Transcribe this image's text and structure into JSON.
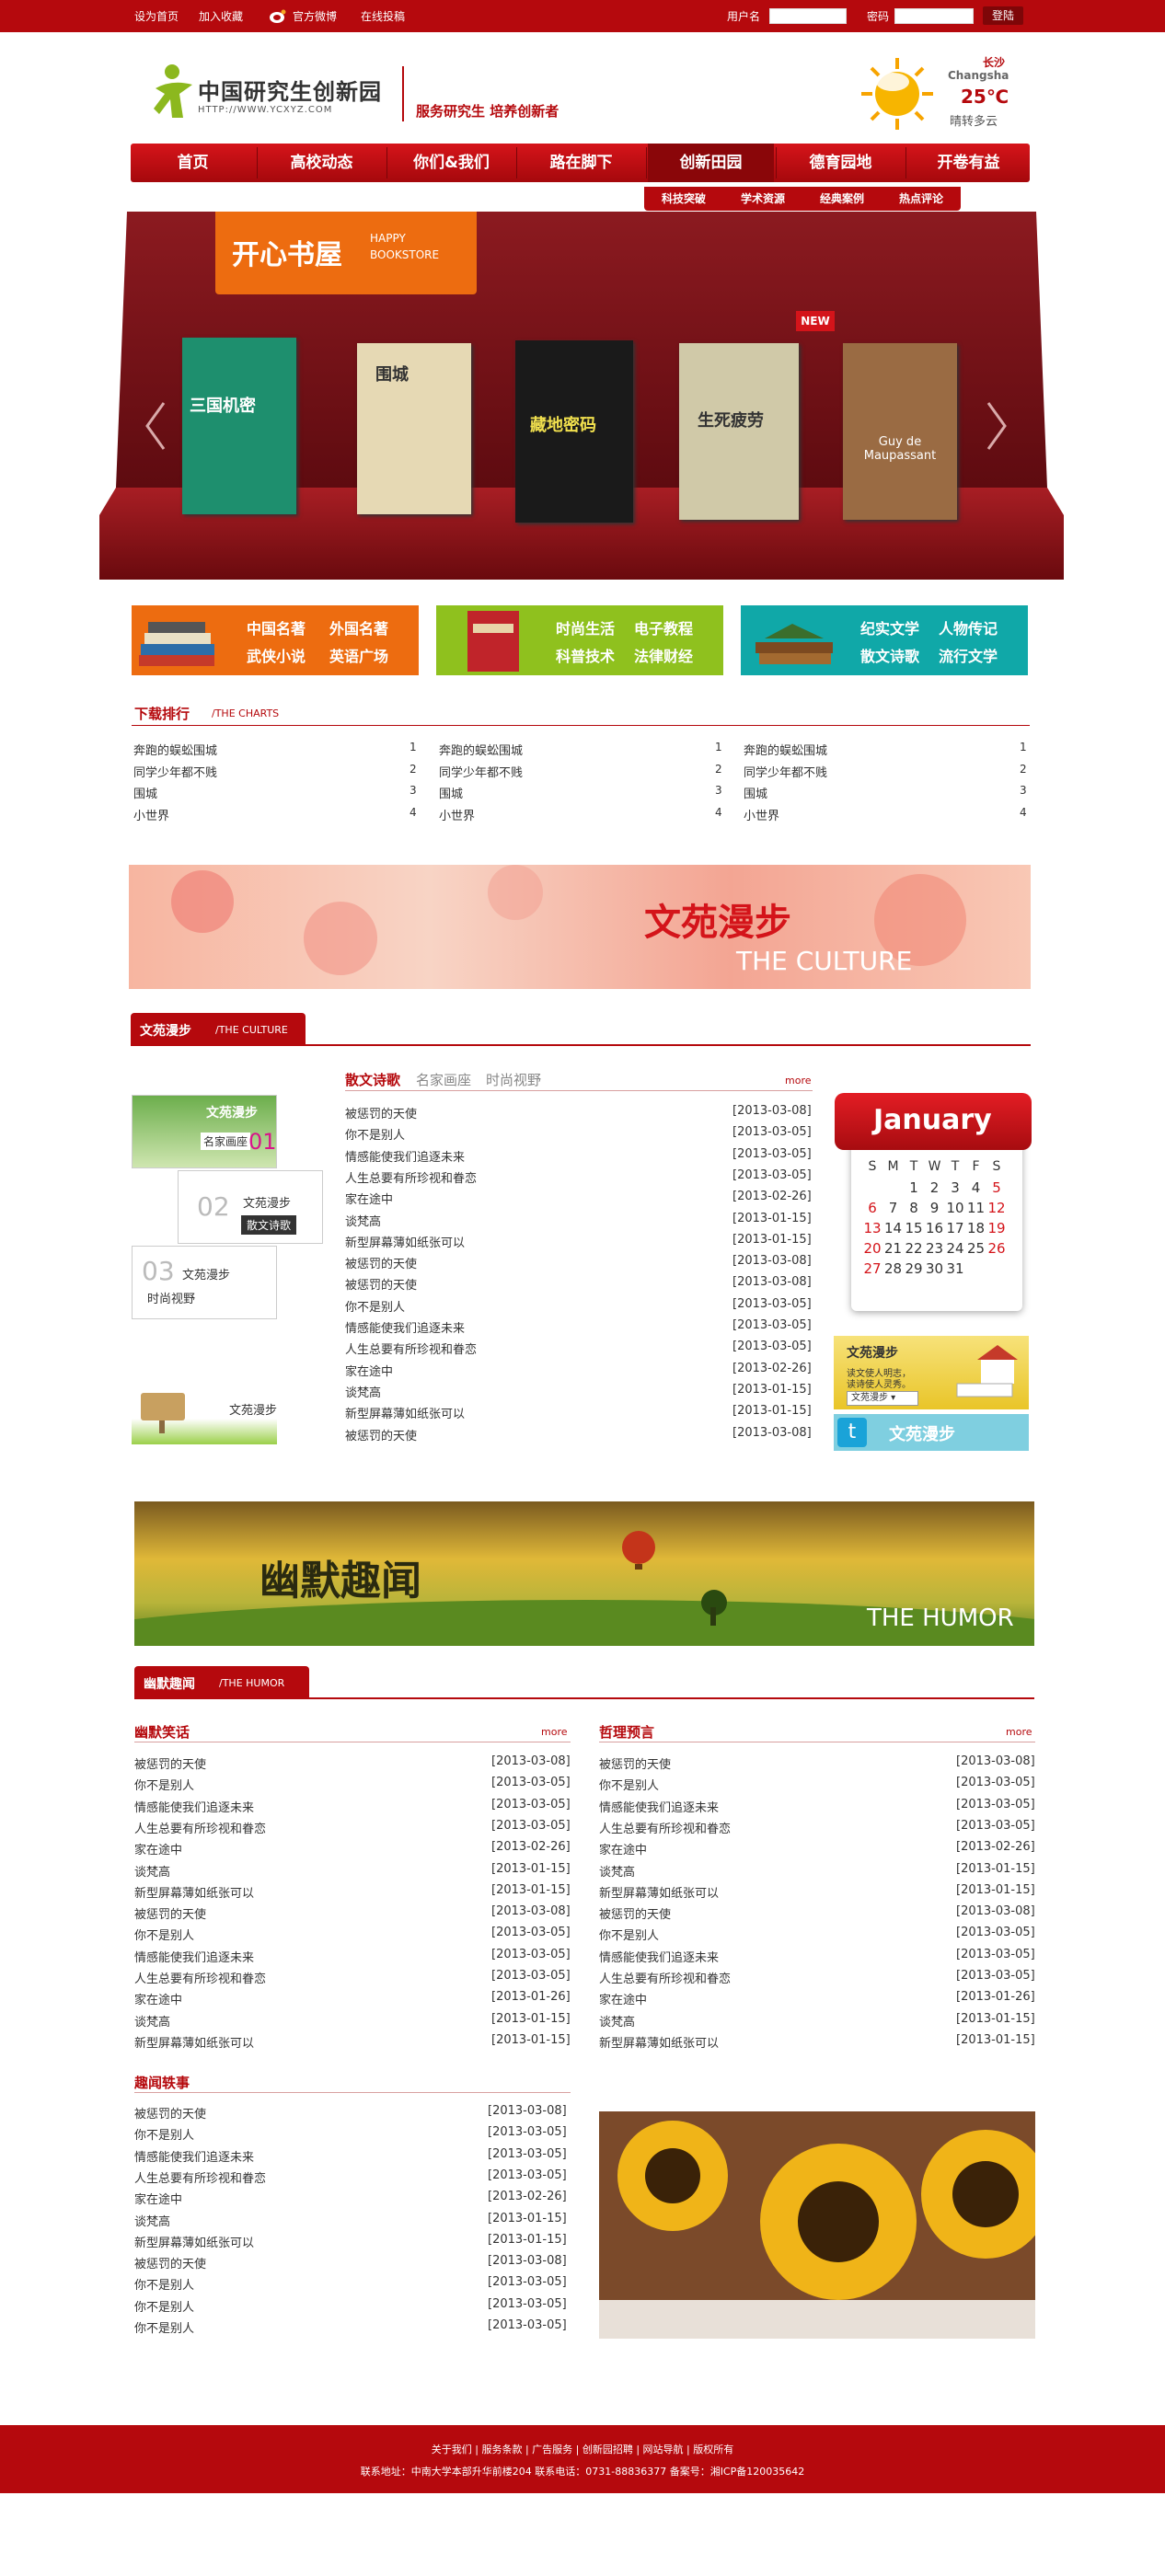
{
  "topbar": {
    "links": [
      "设为首页",
      "加入收藏",
      "官方微博",
      "在线投稿"
    ],
    "username_label": "用户名",
    "password_label": "密码",
    "login_label": "登陆"
  },
  "header": {
    "logo_text": "中国研究生创新园",
    "logo_url": "HTTP://WWW.YCXYZ.COM",
    "slogan": "服务研究生  培养创新者",
    "weather": {
      "city": "长沙",
      "city_en": "Changsha",
      "temp": "25℃",
      "desc": "晴转多云"
    }
  },
  "nav": {
    "items": [
      "首页",
      "高校动态",
      "你们&我们",
      "路在脚下",
      "创新田园",
      "德育园地",
      "开卷有益"
    ],
    "sub_items": [
      "科技突破",
      "学术资源",
      "经典案例",
      "热点评论"
    ]
  },
  "bookstore": {
    "title": "开心书屋",
    "title_en_1": "HAPPY",
    "title_en_2": "BOOKSTORE",
    "new_badge": "NEW",
    "books": [
      {
        "name": "三国机密",
        "color": "#2a8f72"
      },
      {
        "name": "围城",
        "color": "#d9c9a0"
      },
      {
        "name": "藏地密码",
        "color": "#222"
      },
      {
        "name": "生死疲劳",
        "color": "#c9c4a8"
      },
      {
        "name": "Guy de Maupassant",
        "color": "#9a6b43"
      }
    ]
  },
  "categories": [
    {
      "links": [
        "中国名著",
        "外国名著",
        "武侠小说",
        "英语广场"
      ],
      "color": "#ed6c10"
    },
    {
      "links": [
        "时尚生活",
        "电子教程",
        "科普技术",
        "法律财经"
      ],
      "color": "#8fc11e"
    },
    {
      "links": [
        "纪实文学",
        "人物传记",
        "散文诗歌",
        "流行文学"
      ],
      "color": "#10a8a8"
    }
  ],
  "charts": {
    "title": "下载排行",
    "title_en": "/THE CHARTS",
    "columns": [
      [
        "奔跑的蜈蚣围城",
        "同学少年都不贱",
        "围城",
        "小世界"
      ],
      [
        "奔跑的蜈蚣围城",
        "同学少年都不贱",
        "围城",
        "小世界"
      ],
      [
        "奔跑的蜈蚣围城",
        "同学少年都不贱",
        "围城",
        "小世界"
      ]
    ],
    "nums": [
      "1",
      "2",
      "3",
      "4"
    ]
  },
  "culture_banner": {
    "cn": "文苑漫步",
    "en": "THE CULTURE"
  },
  "culture": {
    "tag": "文苑漫步",
    "tag_en": "/THE CULTURE",
    "tabs": [
      "散文诗歌",
      "名家画座",
      "时尚视野"
    ],
    "more": "more",
    "side_items": [
      "文苑漫步",
      "名家画座",
      "01",
      "02",
      "文苑漫步",
      "散文诗歌",
      "03",
      "文苑漫步",
      "时尚视野",
      "文苑漫步"
    ],
    "rows": [
      [
        "被惩罚的天使",
        "[2013-03-08]"
      ],
      [
        "你不是别人",
        "[2013-03-05]"
      ],
      [
        "情感能使我们追逐未来",
        "[2013-03-05]"
      ],
      [
        "人生总要有所珍视和眷恋",
        "[2013-03-05]"
      ],
      [
        "家在途中",
        "[2013-02-26]"
      ],
      [
        "谈梵高",
        "[2013-01-15]"
      ],
      [
        "新型屏幕薄如纸张可以",
        "[2013-01-15]"
      ],
      [
        "被惩罚的天使",
        "[2013-03-08]"
      ],
      [
        "被惩罚的天使",
        "[2013-03-08]"
      ],
      [
        "你不是别人",
        "[2013-03-05]"
      ],
      [
        "情感能使我们追逐未来",
        "[2013-03-05]"
      ],
      [
        "人生总要有所珍视和眷恋",
        "[2013-03-05]"
      ],
      [
        "家在途中",
        "[2013-02-26]"
      ],
      [
        "谈梵高",
        "[2013-01-15]"
      ],
      [
        "新型屏幕薄如纸张可以",
        "[2013-01-15]"
      ],
      [
        "被惩罚的天使",
        "[2013-03-08]"
      ]
    ]
  },
  "calendar": {
    "month": "January",
    "days_header": [
      "S",
      "M",
      "T",
      "W",
      "T",
      "F",
      "S"
    ],
    "weeks": [
      [
        "",
        "",
        "1",
        "2",
        "3",
        "4",
        "5"
      ],
      [
        "6",
        "7",
        "8",
        "9",
        "10",
        "11",
        "12"
      ],
      [
        "13",
        "14",
        "15",
        "16",
        "17",
        "18",
        "19"
      ],
      [
        "20",
        "21",
        "22",
        "23",
        "24",
        "25",
        "26"
      ],
      [
        "27",
        "28",
        "29",
        "30",
        "31",
        "",
        ""
      ]
    ]
  },
  "side_promo": {
    "title": "文苑漫步",
    "line1": "读文使人明志，",
    "line2": "读诗使人灵秀。",
    "select": "文苑漫步",
    "weibo": "文苑漫步"
  },
  "humor_banner": {
    "cn": "幽默趣闻",
    "en": "THE HUMOR"
  },
  "humor": {
    "tag": "幽默趣闻",
    "tag_en": "/THE HUMOR",
    "more": "more",
    "col1_title": "幽默笑话",
    "col2_title": "哲理预言",
    "col3_title": "趣闻轶事",
    "rows": [
      [
        "被惩罚的天使",
        "[2013-03-08]"
      ],
      [
        "你不是别人",
        "[2013-03-05]"
      ],
      [
        "情感能使我们追逐未来",
        "[2013-03-05]"
      ],
      [
        "人生总要有所珍视和眷恋",
        "[2013-03-05]"
      ],
      [
        "家在途中",
        "[2013-02-26]"
      ],
      [
        "谈梵高",
        "[2013-01-15]"
      ],
      [
        "新型屏幕薄如纸张可以",
        "[2013-01-15]"
      ],
      [
        "被惩罚的天使",
        "[2013-03-08]"
      ],
      [
        "你不是别人",
        "[2013-03-05]"
      ],
      [
        "情感能使我们追逐未来",
        "[2013-03-05]"
      ],
      [
        "人生总要有所珍视和眷恋",
        "[2013-03-05]"
      ],
      [
        "家在途中",
        "[2013-01-26]"
      ],
      [
        "谈梵高",
        "[2013-01-15]"
      ],
      [
        "新型屏幕薄如纸张可以",
        "[2013-01-15]"
      ]
    ],
    "rows3": [
      [
        "被惩罚的天使",
        "[2013-03-08]"
      ],
      [
        "你不是别人",
        "[2013-03-05]"
      ],
      [
        "情感能使我们追逐未来",
        "[2013-03-05]"
      ],
      [
        "人生总要有所珍视和眷恋",
        "[2013-03-05]"
      ],
      [
        "家在途中",
        "[2013-02-26]"
      ],
      [
        "谈梵高",
        "[2013-01-15]"
      ],
      [
        "新型屏幕薄如纸张可以",
        "[2013-01-15]"
      ],
      [
        "被惩罚的天使",
        "[2013-03-08]"
      ],
      [
        "你不是别人",
        "[2013-03-05]"
      ],
      [
        "你不是别人",
        "[2013-03-05]"
      ],
      [
        "你不是别人",
        "[2013-03-05]"
      ]
    ]
  },
  "footer": {
    "links": "关于我们 | 服务条款 | 广告服务 | 创新园招聘 | 网站导航 | 版权所有",
    "address": "联系地址：中南大学本部升华前楼204 联系电话：0731-88836377 备案号：湘ICP备120035642"
  },
  "colors": {
    "brand": "#b5090d",
    "dark": "#7e0608",
    "orange": "#ed6c10",
    "green": "#8fc11e",
    "teal": "#10a8a8"
  }
}
